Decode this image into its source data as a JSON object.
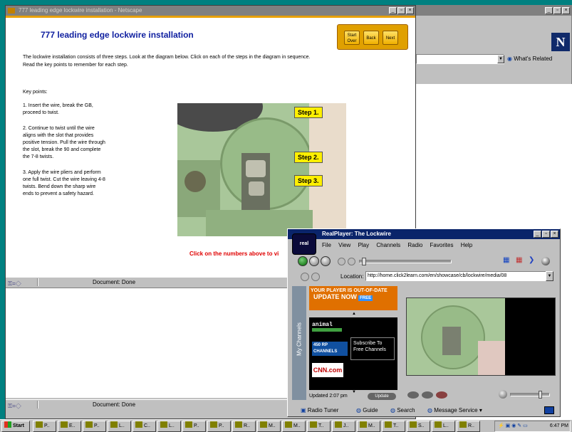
{
  "back_window": {
    "title_buttons": [
      "_",
      "▫",
      "×"
    ],
    "whats_related": "What's Related",
    "logo_letter": "N"
  },
  "netscape": {
    "title": "777 leading edge lockwire installation - Netscape",
    "page_heading": "777 leading edge lockwire installation",
    "nav_buttons": [
      {
        "label": "Start Over"
      },
      {
        "label": "Back"
      },
      {
        "label": "Next"
      }
    ],
    "intro": "The lockwire installation consists of three steps. Look at the diagram below. Click on each of the steps in the diagram in sequence. Read the key points to remember for each step.",
    "key_points_title": "Key points:",
    "key_points": [
      "1. Insert the wire, break the GB, proceed to twist.",
      "2. Continue to twist until the wire aligns with the slot that provides positive tension. Pull the wire through the slot, break the 90 and complete the 7-8 twists.",
      "3. Apply the wire pliers and perform one full twist. Cut the wire leaving 4-8 twists. Bend down the sharp wire ends to prevent a safety hazard."
    ],
    "steps": [
      "Step 1.",
      "Step 2.",
      "Step 3."
    ],
    "click_hint": "Click on the numbers above to vi",
    "status_text": "Document: Done",
    "status_text_2": "Document: Done"
  },
  "realplayer": {
    "title": "RealPlayer: The Lockwire",
    "menu": [
      "File",
      "View",
      "Play",
      "Channels",
      "Radio",
      "Favorites",
      "Help"
    ],
    "location_label": "Location:",
    "location_value": "http://home.click2learn.com/en/showcase/cb/lockwire/media/08",
    "ad_line1": "YOUR PLAYER IS OUT-OF-DATE",
    "ad_line2": "UPDATE NOW",
    "ad_badge": "FREE",
    "animal_label": "animal",
    "channels_label": "450 RP CHANNELS",
    "subscribe_text": "Subscribe To Free Channels",
    "cnn_label": "CNN.com",
    "updated_text": "Updated 2:07 pm",
    "update_button": "Update",
    "my_channels": "My Channels",
    "bottom_links": [
      "Radio Tuner",
      "Guide",
      "Search",
      "Message Service"
    ],
    "bottom_arrow": "▾"
  },
  "taskbar": {
    "start_label": "Start",
    "items": [
      "P..",
      "E..",
      "P..",
      "L..",
      "C..",
      "L..",
      "P..",
      "P..",
      "R..",
      "M..",
      "M..",
      "T..",
      "J..",
      "M..",
      "T..",
      "S..",
      "L..",
      "R.."
    ],
    "clock": "6:47 PM"
  }
}
